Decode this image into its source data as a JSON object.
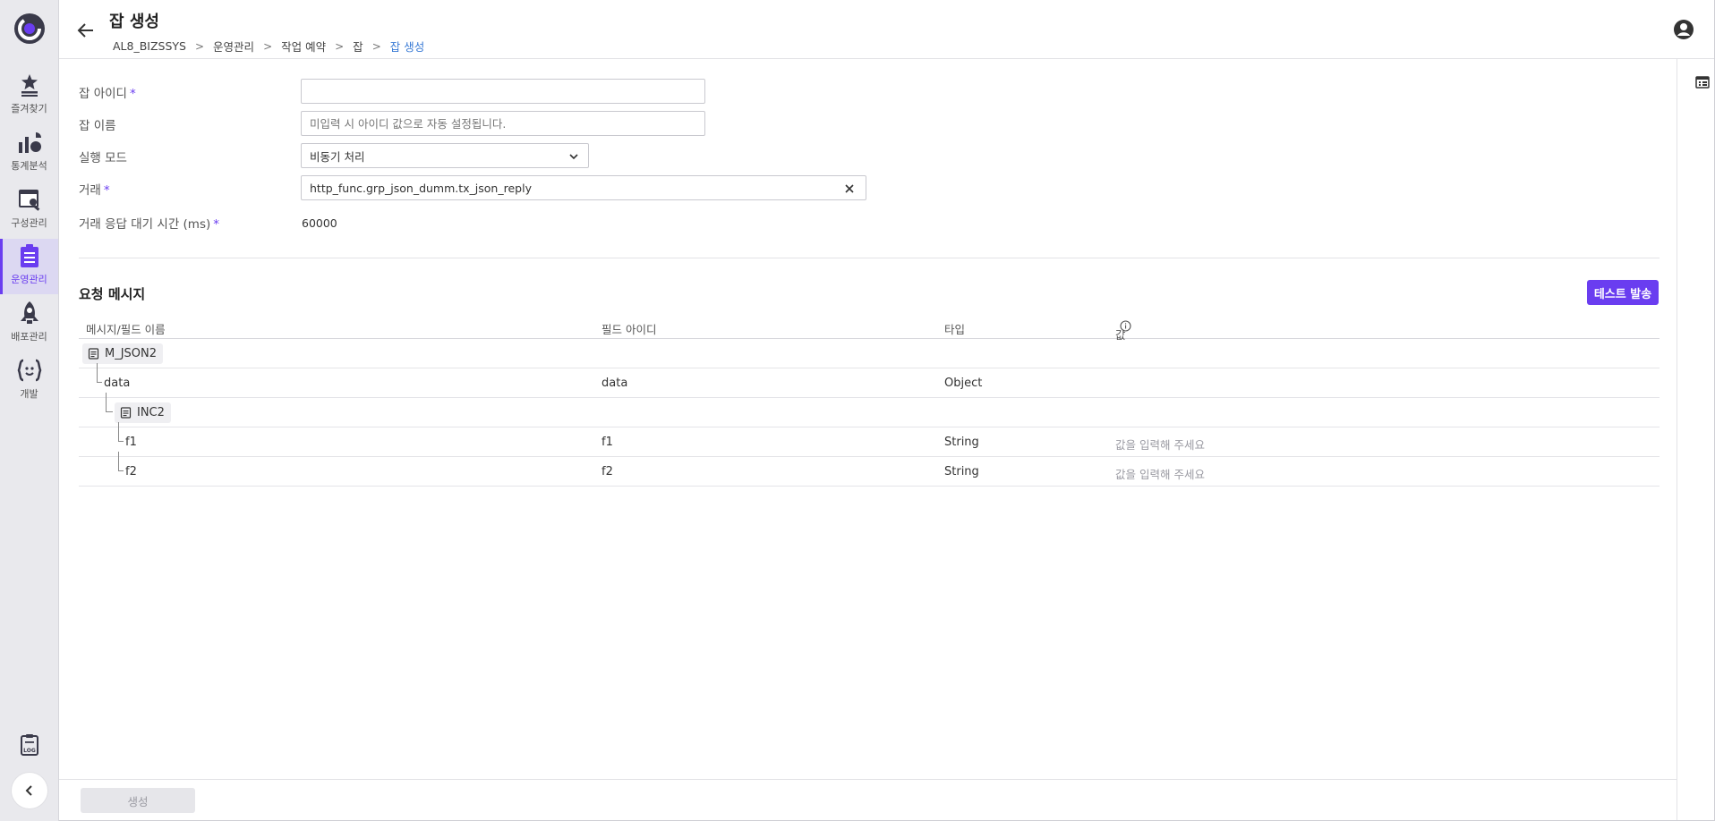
{
  "sidebar": {
    "items": [
      {
        "label": "즐겨찾기",
        "icon": "star-list-icon"
      },
      {
        "label": "통계분석",
        "icon": "chart-icon"
      },
      {
        "label": "구성관리",
        "icon": "config-icon"
      },
      {
        "label": "운영관리",
        "icon": "clipboard-list-icon",
        "active": true
      },
      {
        "label": "배포관리",
        "icon": "rocket-icon"
      },
      {
        "label": "개발",
        "icon": "code-braces-icon"
      }
    ],
    "log_icon": "log-icon",
    "collapse_icon": "chevron-left-icon"
  },
  "header": {
    "title": "잡 생성",
    "breadcrumb": [
      "AL8_BIZSSYS",
      "운영관리",
      "작업 예약",
      "잡",
      "잡 생성"
    ],
    "user_icon": "account-circle-icon"
  },
  "form": {
    "job_id": {
      "label": "잡 아이디",
      "required": "*",
      "value": ""
    },
    "job_name": {
      "label": "잡 이름",
      "placeholder": "미입력 시 아이디 값으로 자동 설정됩니다."
    },
    "exec_mode": {
      "label": "실행 모드",
      "value": "비동기 처리"
    },
    "transaction": {
      "label": "거래",
      "required": "*",
      "value": "http_func.grp_json_dumm.tx_json_reply"
    },
    "timeout": {
      "label": "거래 응답 대기 시간 (ms)",
      "required": "*",
      "value": "60000"
    }
  },
  "request": {
    "title": "요청 메시지",
    "test_button": "테스트 발송",
    "columns": [
      "메시지/필드 이름",
      "필드 아이디",
      "타입",
      "값"
    ],
    "rows": [
      {
        "kind": "message",
        "name": "M_JSON2"
      },
      {
        "kind": "field",
        "name": "data",
        "field_id": "data",
        "type": "Object",
        "value": ""
      },
      {
        "kind": "message",
        "name": "INC2"
      },
      {
        "kind": "field",
        "name": "f1",
        "field_id": "f1",
        "type": "String",
        "placeholder": "값을 입력해 주세요"
      },
      {
        "kind": "field",
        "name": "f2",
        "field_id": "f2",
        "type": "String",
        "placeholder": "값을 입력해 주세요"
      }
    ]
  },
  "footer": {
    "create_button": "생성"
  },
  "colors": {
    "accent": "#6a3df0",
    "breadcrumb_current": "#3a7bd5"
  }
}
